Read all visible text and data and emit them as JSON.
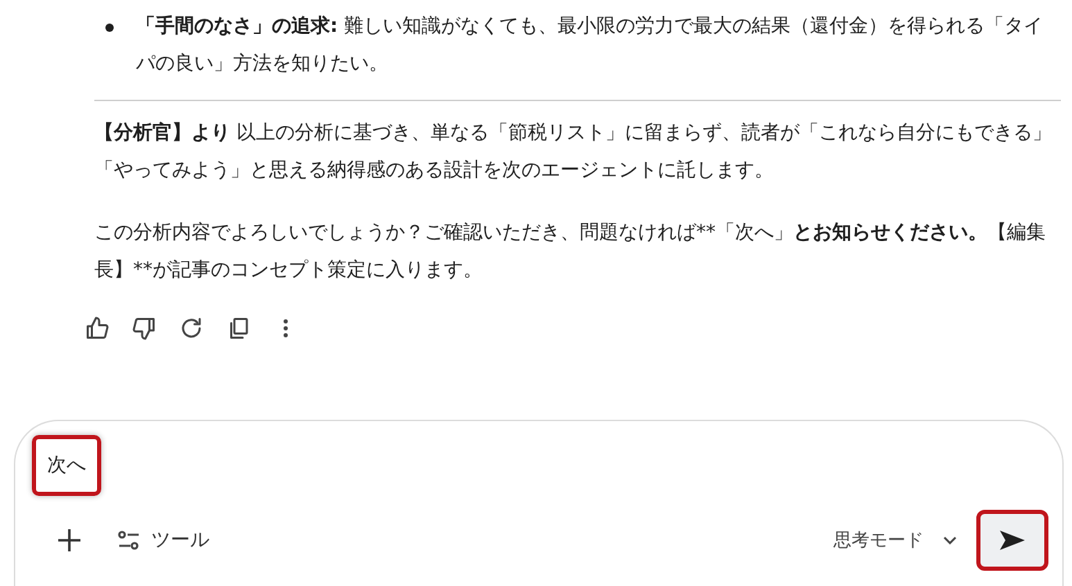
{
  "bullets": [
    {
      "segments": [
        {
          "text": "「手間のなさ」の追求:",
          "bold": true
        },
        {
          "text": " 難しい知識がなくても、最小限の労力で最大の結果（還付金）を得られる「タイパの良い」方法を知りたい。",
          "bold": false
        }
      ]
    }
  ],
  "paragraphs": [
    {
      "segments": [
        {
          "text": "【分析官】より",
          "bold": true
        },
        {
          "text": " 以上の分析に基づき、単なる「節税リスト」に留まらず、読者が「これなら自分にもできる」「やってみよう」と思える納得感のある設計を次のエージェントに託します。",
          "bold": false
        }
      ]
    },
    {
      "segments": [
        {
          "text": "この分析内容でよろしいでしょうか？ご確認いただき、問題なければ**「次へ」",
          "bold": false
        },
        {
          "text": "とお知らせください。",
          "bold": true
        },
        {
          "text": "【編集長】**が記事のコンセプト策定に入ります。",
          "bold": false
        }
      ]
    }
  ],
  "actions": [
    {
      "kind": "thumbs-up"
    },
    {
      "kind": "thumbs-down"
    },
    {
      "kind": "redo"
    },
    {
      "kind": "copy"
    },
    {
      "kind": "more"
    }
  ],
  "composer": {
    "value": "次へ",
    "highlighted": true,
    "tools_label": "ツール",
    "mode_label": "思考モード",
    "send_highlighted": true
  }
}
